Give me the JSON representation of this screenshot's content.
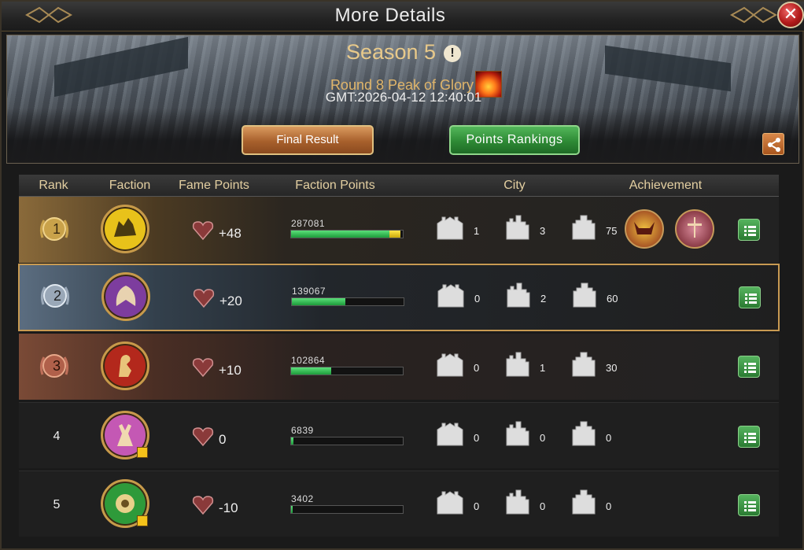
{
  "window": {
    "title": "More Details"
  },
  "banner": {
    "season": "Season 5",
    "round": "Round 8 Peak of Glory",
    "gmt": "GMT:2026-04-12 12:40:01",
    "final_result_label": "Final Result",
    "points_rankings_label": "Points Rankings"
  },
  "columns": {
    "rank": "Rank",
    "faction": "Faction",
    "fame_points": "Fame Points",
    "faction_points": "Faction Points",
    "city": "City",
    "achievement": "Achievement"
  },
  "rows": [
    {
      "rank": "1",
      "fame": "+48",
      "faction_points": "287081",
      "bar_fraction": 0.98,
      "bar_highlight_fraction": 0.1,
      "city_a": "1",
      "city_b": "3",
      "city_c": "75",
      "faction_icon": "wolf-sigil-icon",
      "faction_color": "#e8c21a",
      "achievements": [
        "horned-helm-achievement-icon",
        "sword-achievement-icon"
      ]
    },
    {
      "rank": "2",
      "fame": "+20",
      "faction_points": "139067",
      "bar_fraction": 0.48,
      "city_a": "0",
      "city_b": "2",
      "city_c": "60",
      "faction_icon": "dragon-sigil-icon",
      "faction_color": "#7d3d9e"
    },
    {
      "rank": "3",
      "fame": "+10",
      "faction_points": "102864",
      "bar_fraction": 0.36,
      "city_a": "0",
      "city_b": "1",
      "city_c": "30",
      "faction_icon": "lion-sigil-icon",
      "faction_color": "#b3281c"
    },
    {
      "rank": "4",
      "fame": "0",
      "faction_points": "6839",
      "bar_fraction": 0.02,
      "city_a": "0",
      "city_b": "0",
      "city_c": "0",
      "faction_icon": "stag-sigil-icon",
      "faction_color": "#c458b4"
    },
    {
      "rank": "5",
      "fame": "-10",
      "faction_points": "3402",
      "bar_fraction": 0.01,
      "city_a": "0",
      "city_b": "0",
      "city_c": "0",
      "faction_icon": "rose-sigil-icon",
      "faction_color": "#2e9a3a"
    }
  ]
}
